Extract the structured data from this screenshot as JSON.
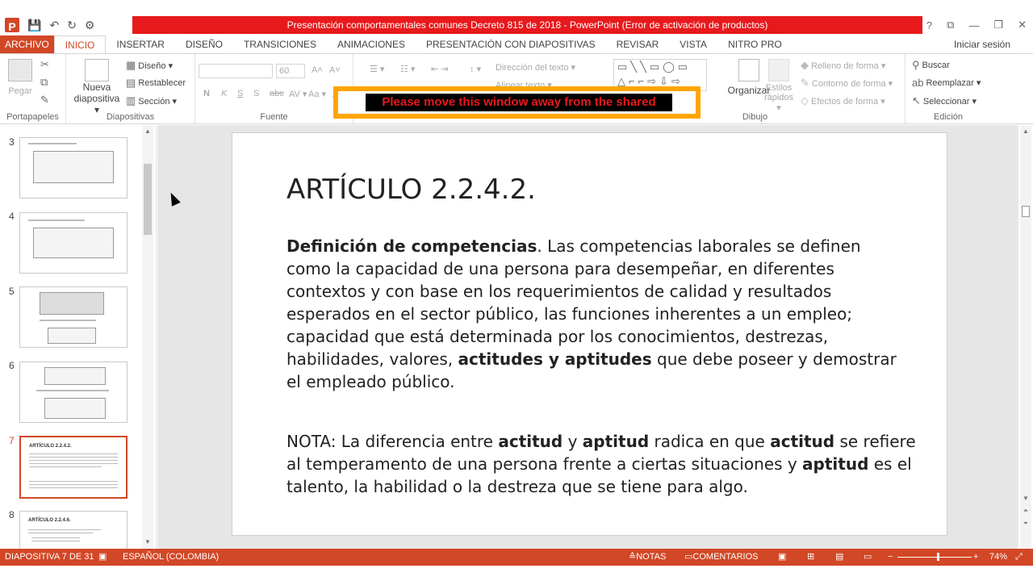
{
  "window": {
    "title": "Presentación comportamentales comunes Decreto 815 de 2018 -  PowerPoint (Error de activación de productos)",
    "help": "?",
    "ribbon_opts": "⧉",
    "minimize": "—",
    "restore": "❐",
    "close": "✕"
  },
  "qat": {
    "logo": "P",
    "save": "💾",
    "undo": "↶",
    "redo": "↻",
    "customize": "⚙"
  },
  "tabs": {
    "file": "ARCHIVO",
    "items": [
      "INICIO",
      "INSERTAR",
      "DISEÑO",
      "TRANSICIONES",
      "ANIMACIONES",
      "PRESENTACIÓN CON DIAPOSITIVAS",
      "REVISAR",
      "VISTA",
      "NITRO PRO"
    ],
    "signin": "Iniciar sesión"
  },
  "ribbon": {
    "portapapeles": {
      "label": "Portapapeles",
      "pegar": "Pegar"
    },
    "diapositivas": {
      "label": "Diapositivas",
      "nueva": "Nueva",
      "diapositiva": "diapositiva ▾",
      "diseno": "Diseño ▾",
      "restablecer": "Restablecer",
      "seccion": "Sección ▾"
    },
    "fuente": {
      "label": "Fuente",
      "size": "60",
      "n": "N",
      "k": "K",
      "s": "S",
      "sh": "S",
      "abc": "abc",
      "av": "AV ▾",
      "aa": "Aa ▾",
      "a": "A ▾"
    },
    "parrafo": {
      "direccion": "Dirección del texto ▾",
      "alinear": "Alinear texto ▾"
    },
    "dibujo": {
      "label": "Dibujo",
      "organizar": "Organizar",
      "estilos1": "Estilos",
      "estilos2": "rápidos ▾",
      "relleno": "Relleno de forma ▾",
      "contorno": "Contorno de forma ▾",
      "efectos": "Efectos de forma ▾"
    },
    "edicion": {
      "label": "Edición",
      "buscar": "Buscar",
      "reemplazar": "Reemplazar  ▾",
      "seleccionar": "Seleccionar ▾"
    }
  },
  "overlay": {
    "warning": "Please move this window away from the shared"
  },
  "thumbnails": {
    "numbers": [
      "3",
      "4",
      "5",
      "6",
      "7",
      "8"
    ],
    "t7_title": "ARTÍCULO 2.2.4.2.",
    "t8_title": "ARTÍCULO 2.2.4.6."
  },
  "slide": {
    "title": "ARTÍCULO 2.2.4.2.",
    "p1_bold": "Definición de competencias",
    "p1_a": ". Las competencias laborales se definen como la capacidad de una persona para desempeñar, en diferentes contextos y con base en los requerimientos de calidad y resultados esperados en el sector público, las funciones inherentes a un empleo; capacidad que está determinada por los conocimientos, destrezas, habilidades, valores, ",
    "p1_bold2": "actitudes y aptitudes",
    "p1_b": " que debe poseer y demostrar el empleado público.",
    "n1": "NOTA: La diferencia entre ",
    "n_b1": "actitud",
    "n2": " y ",
    "n_b2": "aptitud",
    "n3": " radica en que ",
    "n_b3": "actitud",
    "n4": " se refiere al temperamento de una persona frente a ciertas situaciones y ",
    "n_b4": "aptitud",
    "n5": " es el talento, la habilidad o la destreza que se tiene para algo."
  },
  "status": {
    "slide": "DIAPOSITIVA 7 DE 31",
    "lang": "ESPAÑOL (COLOMBIA)",
    "notas": "NOTAS",
    "comentarios": "COMENTARIOS",
    "zoom": "74%",
    "zoom_level": 0.55
  }
}
